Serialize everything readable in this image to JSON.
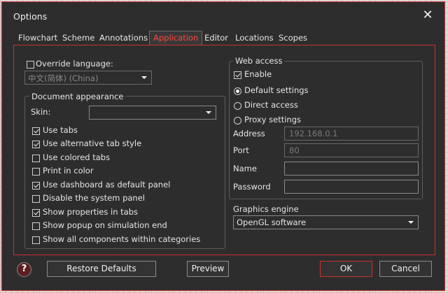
{
  "window": {
    "title": "Options"
  },
  "tabs": [
    "Flowchart",
    "Scheme",
    "Annotations",
    "Application",
    "Editor",
    "Locations",
    "Scopes"
  ],
  "active_tab": "Application",
  "language": {
    "label": "Override language:",
    "checked": false,
    "value": "中文(简体) (China)"
  },
  "document_appearance": {
    "title": "Document appearance",
    "skin_label": "Skin:",
    "skin_value": "",
    "options": [
      {
        "label": "Use tabs",
        "checked": true
      },
      {
        "label": "Use alternative tab style",
        "checked": true
      },
      {
        "label": "Use colored tabs",
        "checked": false
      },
      {
        "label": "Print in color",
        "checked": false
      },
      {
        "label": "Use dashboard as default panel",
        "checked": true
      },
      {
        "label": "Disable the system panel",
        "checked": false
      },
      {
        "label": "Show properties in tabs",
        "checked": true
      },
      {
        "label": "Show popup on simulation end",
        "checked": false
      },
      {
        "label": "Show all components within categories",
        "checked": false
      }
    ]
  },
  "web_access": {
    "title": "Web access",
    "enable": {
      "label": "Enable",
      "checked": true
    },
    "modes": [
      {
        "label": "Default settings",
        "selected": true
      },
      {
        "label": "Direct access",
        "selected": false
      },
      {
        "label": "Proxy settings",
        "selected": false
      }
    ],
    "address": {
      "label": "Address",
      "value": "192.168.0.1"
    },
    "port": {
      "label": "Port",
      "value": "80"
    },
    "name": {
      "label": "Name",
      "value": ""
    },
    "password": {
      "label": "Password",
      "value": ""
    }
  },
  "graphics": {
    "title": "Graphics engine",
    "value": "OpenGL software"
  },
  "buttons": {
    "restore": "Restore Defaults",
    "preview": "Preview",
    "ok": "OK",
    "cancel": "Cancel"
  },
  "colors": {
    "accent": "#c8322f",
    "active_tab_text": "#ff4a3d",
    "background": "#2d2d2d"
  }
}
